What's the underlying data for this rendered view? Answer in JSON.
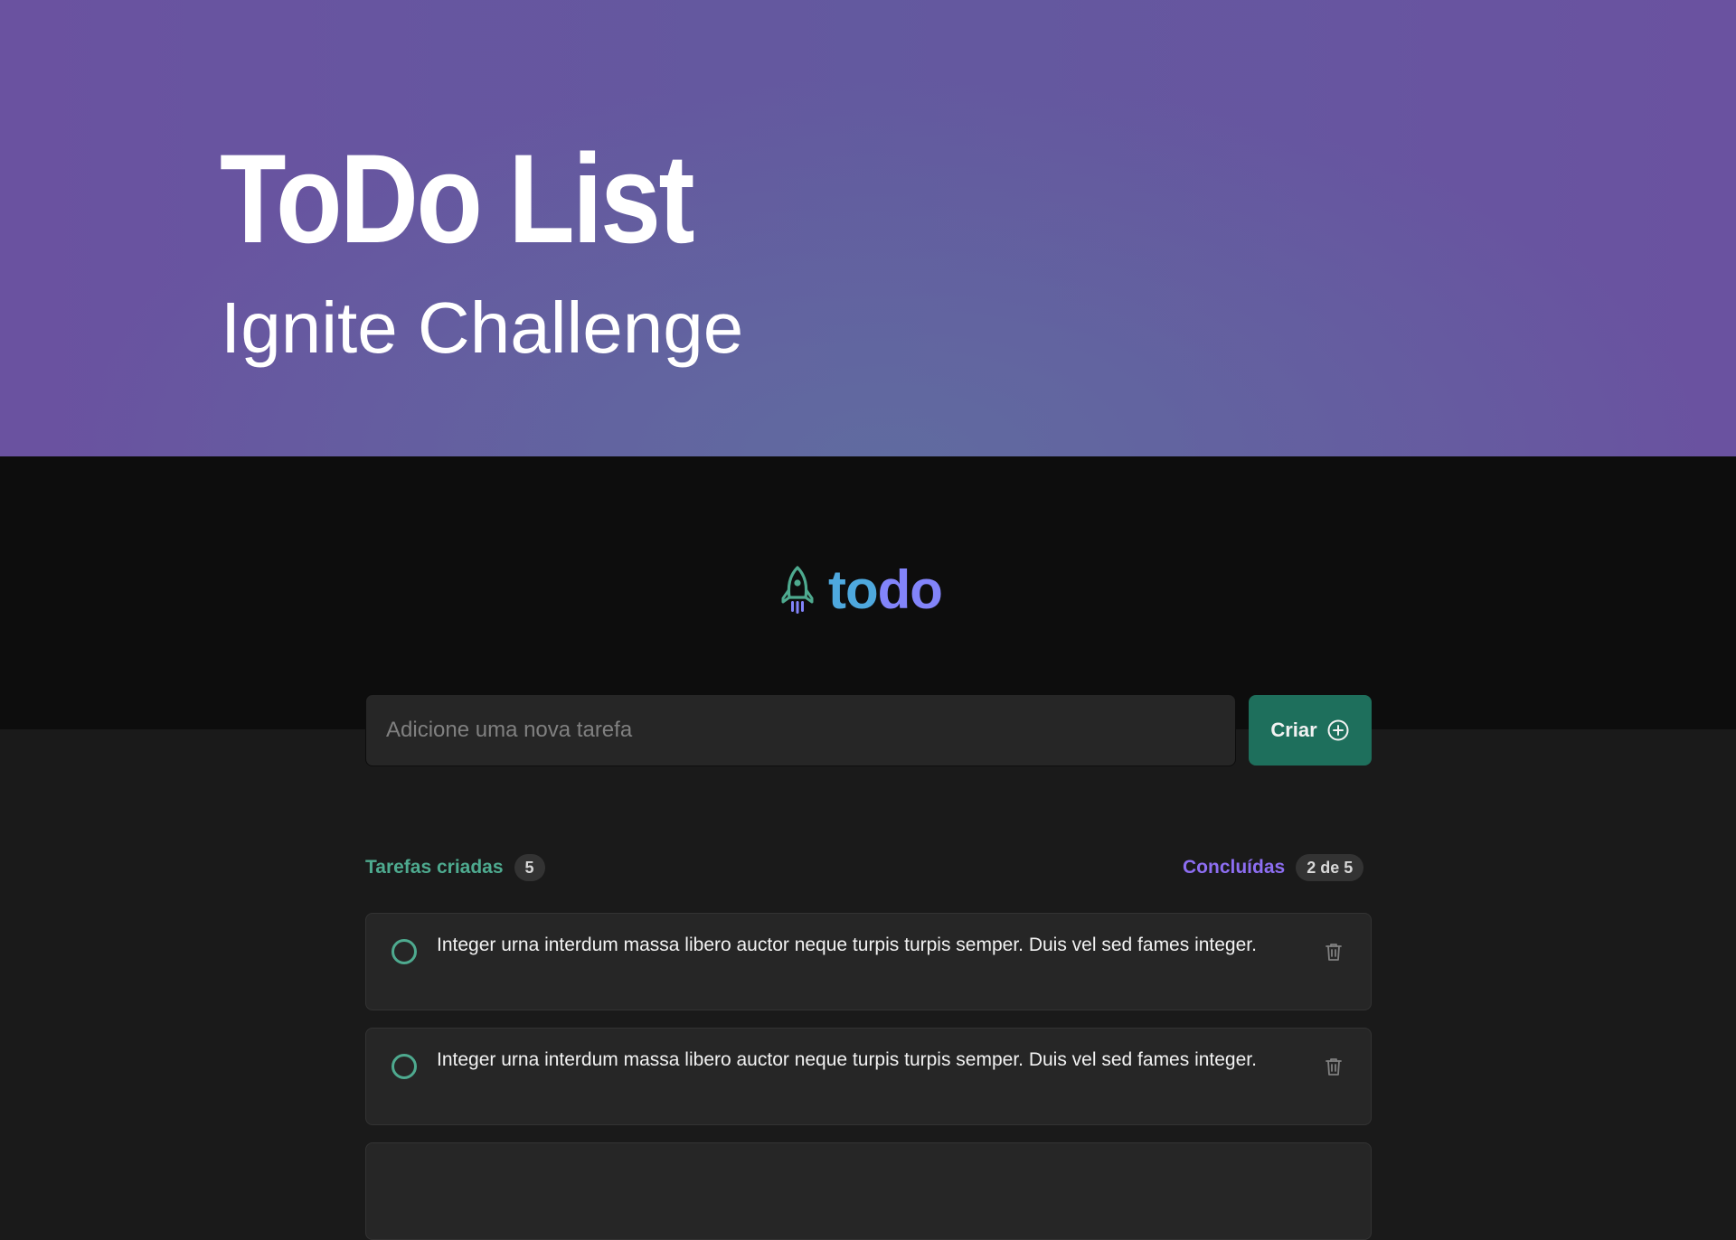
{
  "hero": {
    "title": "ToDo List",
    "subtitle": "Ignite Challenge"
  },
  "logo": {
    "icon": "rocket-icon",
    "text_part1": "to",
    "text_part2": "do"
  },
  "new_task": {
    "placeholder": "Adicione uma nova tarefa",
    "button_label": "Criar",
    "button_icon": "plus-circle-icon"
  },
  "counters": {
    "created_label": "Tarefas criadas",
    "created_count": "5",
    "done_label": "Concluídas",
    "done_count": "2 de 5"
  },
  "tasks": [
    {
      "text": "Integer urna interdum massa libero auctor neque turpis turpis semper. Duis vel sed fames integer.",
      "completed": false,
      "delete_icon": "trash-icon"
    },
    {
      "text": "Integer urna interdum massa libero auctor neque turpis turpis semper. Duis vel sed fames integer.",
      "completed": false,
      "delete_icon": "trash-icon"
    }
  ],
  "colors": {
    "hero_purple": "#6a52a0",
    "brand_blue": "#4ea8de",
    "brand_purple": "#8284fa",
    "created_green": "#4eaa8f",
    "done_purple": "#8d6ef2",
    "button_green": "#1e6f5c",
    "card_bg": "#262626",
    "page_bg": "#1a1a1a"
  }
}
